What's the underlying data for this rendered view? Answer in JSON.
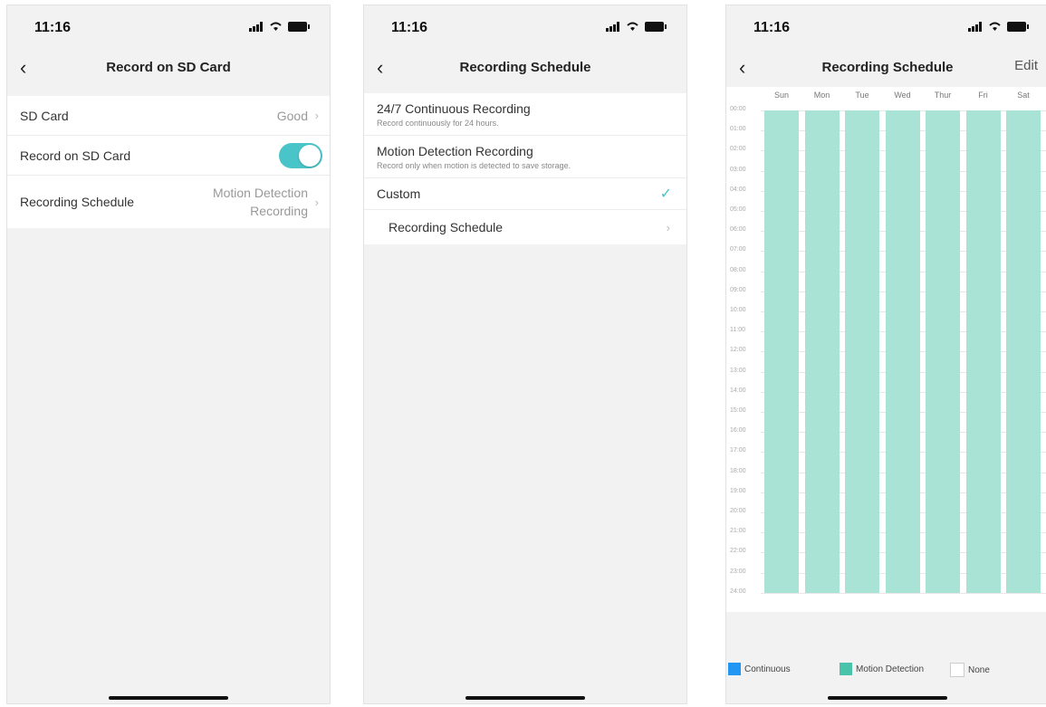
{
  "status": {
    "time": "11:16"
  },
  "screen1": {
    "title": "Record on SD Card",
    "rows": [
      {
        "label": "SD Card",
        "value": "Good"
      },
      {
        "label": "Record on SD Card"
      },
      {
        "label": "Recording Schedule",
        "value_line1": "Motion Detection",
        "value_line2": "Recording"
      }
    ],
    "toggle_on": true
  },
  "screen2": {
    "title": "Recording Schedule",
    "options": [
      {
        "title": "24/7 Continuous Recording",
        "subtitle": "Record continuously for 24 hours."
      },
      {
        "title": "Motion Detection Recording",
        "subtitle": "Record only when motion is detected to save storage."
      },
      {
        "title": "Custom",
        "selected": true
      }
    ],
    "sub_row": "Recording Schedule"
  },
  "screen3": {
    "title": "Recording Schedule",
    "edit": "Edit",
    "days": [
      "Sun",
      "Mon",
      "Tue",
      "Wed",
      "Thur",
      "Fri",
      "Sat"
    ],
    "hours": [
      "00:00",
      "01:00",
      "02:00",
      "03:00",
      "04:00",
      "05:00",
      "06:00",
      "07:00",
      "08:00",
      "09:00",
      "10:00",
      "11:00",
      "12:00",
      "13:00",
      "14:00",
      "15:00",
      "16:00",
      "17:00",
      "18:00",
      "19:00",
      "20:00",
      "21:00",
      "22:00",
      "23:00",
      "24:00"
    ],
    "schedule_mode_all": "Motion Detection",
    "legend": [
      {
        "label": "Continuous",
        "color": "#2196f3"
      },
      {
        "label": "Motion Detection",
        "color": "#49c4aa"
      },
      {
        "label": "None",
        "color": "#ffffff"
      }
    ]
  },
  "colors": {
    "accent": "#49c4c8",
    "motion": "#a8e3d6"
  }
}
